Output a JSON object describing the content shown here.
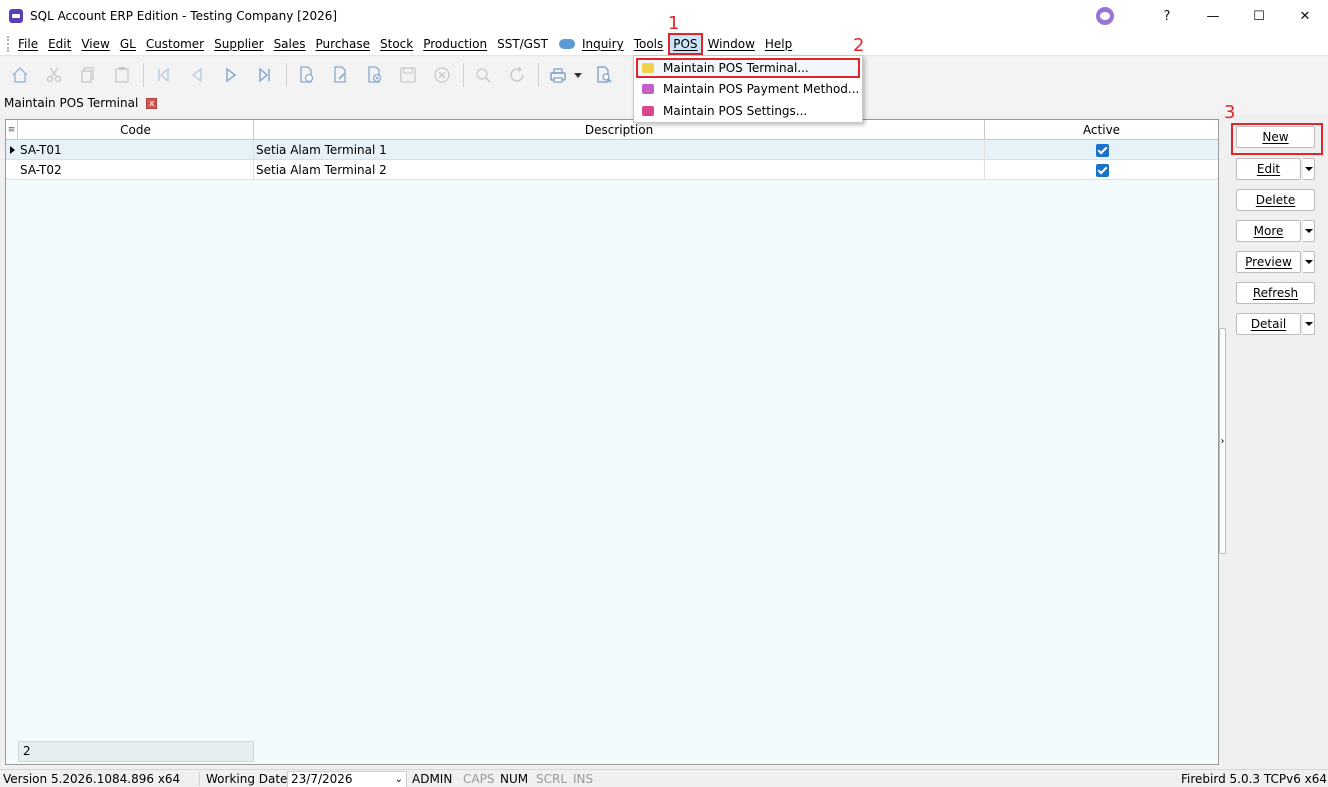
{
  "window": {
    "title": "SQL Account ERP Edition - Testing Company [2026]",
    "help_label": "?",
    "minimize_label": "—",
    "maximize_label": "☐",
    "close_label": "✕"
  },
  "menu": {
    "items": [
      "File",
      "Edit",
      "View",
      "GL",
      "Customer",
      "Supplier",
      "Sales",
      "Purchase",
      "Stock",
      "Production",
      "SST/GST",
      "Inquiry",
      "Tools",
      "POS",
      "Window",
      "Help"
    ],
    "active": "POS"
  },
  "toolbar": {
    "icons": [
      "home-icon",
      "cut-icon",
      "copy-icon",
      "paste-icon",
      "first-record-icon",
      "prior-record-icon",
      "next-record-icon",
      "last-record-icon",
      "new-doc-icon",
      "edit-doc-icon",
      "delete-doc-icon",
      "save-icon",
      "cancel-icon",
      "search-icon",
      "refresh-icon",
      "print-icon",
      "print-preview-icon"
    ]
  },
  "tab": {
    "label": "Maintain POS Terminal",
    "close_label": "x"
  },
  "grid": {
    "columns": [
      "Code",
      "Description",
      "Active"
    ],
    "rows": [
      {
        "code": "SA-T01",
        "description": "Setia Alam Terminal 1",
        "active": true
      },
      {
        "code": "SA-T02",
        "description": "Setia Alam Terminal 2",
        "active": true
      }
    ],
    "footer_count": "2"
  },
  "pos_menu": {
    "items": [
      "Maintain POS Terminal...",
      "Maintain POS Payment Method...",
      "Maintain POS Settings..."
    ],
    "highlighted": "Maintain POS Terminal...",
    "icon_colors": [
      "#f2d14b",
      "#c45fc7",
      "#d9488c"
    ]
  },
  "buttons": {
    "new": "New",
    "edit": "Edit",
    "delete": "Delete",
    "more": "More",
    "preview": "Preview",
    "refresh": "Refresh",
    "detail": "Detail"
  },
  "callouts": [
    "1",
    "2",
    "3"
  ],
  "status": {
    "version": "Version 5.2026.1084.896 x64",
    "working_date_label": "Working Date",
    "working_date": "23/7/2026",
    "user": "ADMIN",
    "caps": "CAPS",
    "num": "NUM",
    "scrl": "SCRL",
    "ins": "INS",
    "db": "Firebird 5.0.3 TCPv6 x64"
  },
  "colors": {
    "accent_red": "#e0262a",
    "checkbox_blue": "#1a73c8",
    "grid_bg": "#f3fafc"
  }
}
